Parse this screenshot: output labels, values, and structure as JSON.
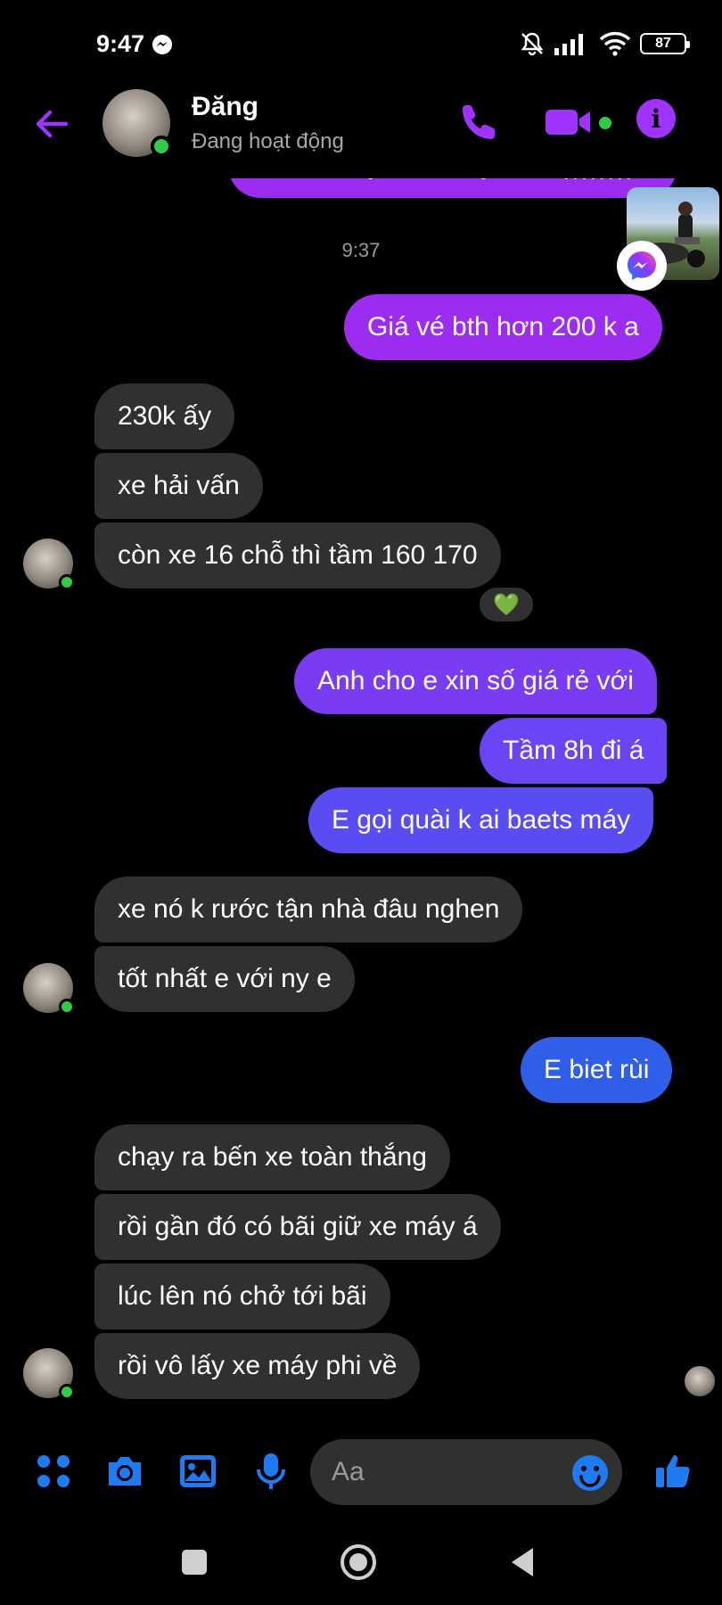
{
  "status_bar": {
    "time": "9:47",
    "battery": "87"
  },
  "header": {
    "name": "Đăng",
    "status": "Đang hoạt động"
  },
  "messages": {
    "cut_top": "Thật mày khi có ny nhi ^ ))))))))",
    "timestamp": "9:37",
    "m1": "Giá vé bth hơn 200 k a",
    "m2": "230k ấy",
    "m3": "xe hải vấn",
    "m4": "còn xe 16 chỗ thì tầm 160 170",
    "reaction": "💚",
    "m5": "Anh cho e xin số giá rẻ với",
    "m6": "Tầm 8h đi á",
    "m7": "E gọi quài k ai baets máy",
    "m8": "xe nó k rước tận nhà đâu nghen",
    "m9": "tốt nhất e với ny e",
    "m10": "E biet rùi",
    "m11": "chạy ra bến xe toàn thắng",
    "m12": "rồi gần đó có bãi giữ xe máy á",
    "m13": "lúc lên nó chở tới bãi",
    "m14": "rồi vô lấy xe máy phi về"
  },
  "composer": {
    "placeholder": "Aa"
  },
  "colors": {
    "accent_purple": "#a033ff",
    "bubble_purple": "#9b2cf0",
    "bubble_violet": "#6a44f5",
    "bubble_blue": "#2f5fe8",
    "bubble_incoming": "#303030",
    "composer_blue": "#1e7bf2",
    "online_green": "#31cc46"
  }
}
